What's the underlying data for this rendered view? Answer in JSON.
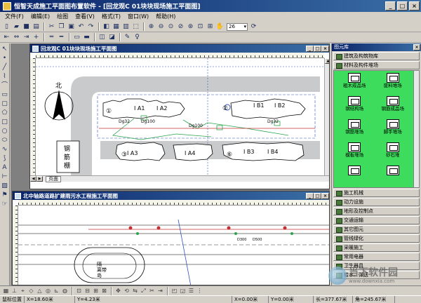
{
  "window": {
    "title": "恒智天成施工平面图布置软件 - [回龙观C 01块块现场施工平面图]",
    "buttons": [
      "_",
      "□",
      "×"
    ]
  },
  "menu": [
    "文件(F)",
    "编辑(E)",
    "绘图",
    "查看(V)",
    "格式(T)",
    "窗口(W)",
    "帮助(H)"
  ],
  "toolbar": {
    "zoom_value": "26"
  },
  "doc1": {
    "title": "回龙观C 01块块现场施工平面图",
    "page_tab": "页面",
    "labels": {
      "north": "北",
      "bldg_ia1": "I A1",
      "bldg_ia2": "I A2",
      "bldg_ib1": "I B1",
      "bldg_ib2": "I B2",
      "bldg_ia3": "I A3",
      "bldg_ia4": "I A4",
      "bldg_ib3": "I B3",
      "bldg_ib4": "I B4",
      "c1": "①",
      "c2": "②",
      "c3": "③",
      "c6": "⑥",
      "dg32a": "Dg32",
      "dg100a": "Dg100",
      "dg100b": "Dg100",
      "dg32b": "Dg32",
      "rebar1": "钢",
      "rebar2": "筋",
      "rebar3": "棚"
    }
  },
  "doc2": {
    "title": "北中轴路道路扩建雨污水工程施工平面图",
    "labels": {
      "island1": "隔",
      "island2": "离带",
      "island3": "岛",
      "pipe1": "D300",
      "pipe2": "D500"
    }
  },
  "library": {
    "title": "图元库",
    "top_categories": [
      "建筑及构筑物库",
      "材料及构件堆场"
    ],
    "items": [
      "粗木成品场",
      "废料堆场",
      "钢结构场",
      "钢筋成品场",
      "钢筋堆场",
      "脚手堆场",
      "模板堆场",
      "砂石堆",
      "",
      ""
    ],
    "bottom_categories": [
      "施工机械",
      "动力设施",
      "地形及控制点",
      "交通运输",
      "其它图元",
      "管线绿化",
      "采暖施工",
      "常用电器",
      "卫生器具",
      "给水、弹送"
    ]
  },
  "status": {
    "label": "鼠标位置",
    "x": "X=18.60米",
    "y": "Y=4.23米",
    "dx": "X=0.00米",
    "dy": "Y=0.00米",
    "length": "长=377.67米",
    "angle": "角=245.67米"
  },
  "watermark": {
    "cn": "当下软件园",
    "url": "www.downxia.com"
  }
}
